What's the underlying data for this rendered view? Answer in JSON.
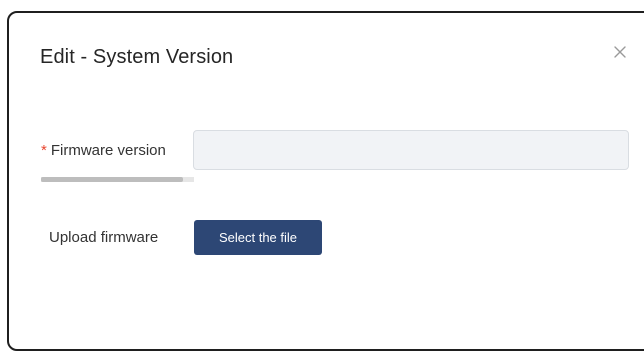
{
  "dialog": {
    "title": "Edit - System Version",
    "close_icon": "close-icon"
  },
  "form": {
    "firmware_version": {
      "required_mark": "*",
      "label": "Firmware version",
      "value": "",
      "placeholder": "",
      "label_scroll_fraction": 0.93
    },
    "upload_firmware": {
      "label": "Upload firmware",
      "button_label": "Select the file"
    }
  },
  "colors": {
    "primary_button": "#2d4775",
    "required": "#e8452e",
    "input_bg": "#f1f3f6"
  }
}
